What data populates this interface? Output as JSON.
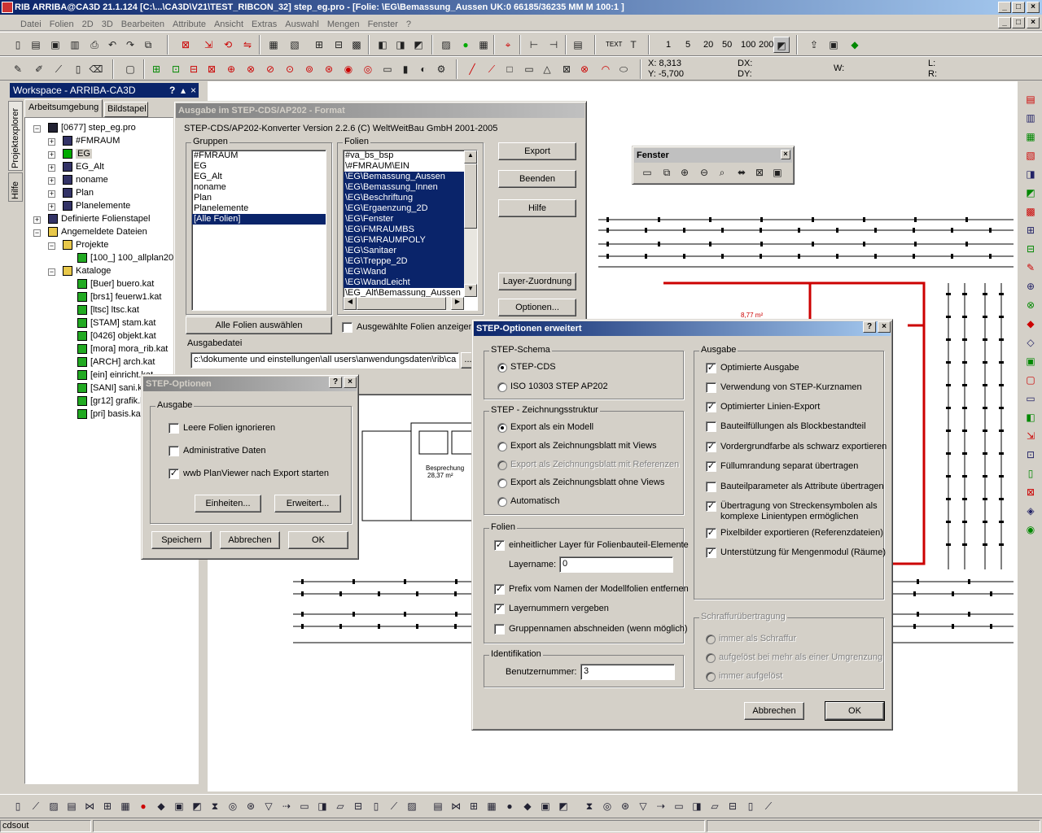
{
  "window": {
    "title": "RIB ARRIBA@CA3D 21.1.124 [C:\\...\\CA3D\\V21\\TEST_RIBCON_32] step_eg.pro - [Folie: \\EG\\Bemassung_Aussen     UK:0     66185/36235 MM     M 100:1     ]",
    "min": "_",
    "max": "□",
    "close": "×",
    "mdi_min": "_",
    "mdi_max": "□",
    "mdi_close": "×"
  },
  "menu": [
    "Datei",
    "Folien",
    "2D",
    "3D",
    "Bearbeiten",
    "Attribute",
    "Ansicht",
    "Extras",
    "Auswahl",
    "Mengen",
    "Fenster",
    "?"
  ],
  "toolbar1": {
    "text_label": "TEXT",
    "scales": [
      "1",
      "5",
      "20",
      "50",
      "100",
      "200"
    ]
  },
  "coords": {
    "x": "X: 8,313",
    "y": "Y: -5,700",
    "dx": "DX:",
    "dy": "DY:",
    "w": "W:",
    "l": "L:",
    "r": "R:"
  },
  "workspace": {
    "title": "Workspace - ARRIBA-CA3D",
    "help_q": "?",
    "pin": "▴",
    "close": "×",
    "tabs": [
      "Arbeitsumgebung",
      "Bildstapel"
    ],
    "side_tabs": [
      "Projektexplorer",
      "Hilfe"
    ],
    "tree": [
      {
        "label": "[0677] step_eg.pro",
        "level": 0,
        "icon": "project"
      },
      {
        "label": "#FMRAUM",
        "level": 1,
        "icon": "layer"
      },
      {
        "label": "EG",
        "level": 1,
        "icon": "layer-active"
      },
      {
        "label": "EG_Alt",
        "level": 1,
        "icon": "layer"
      },
      {
        "label": "noname",
        "level": 1,
        "icon": "layer"
      },
      {
        "label": "Plan",
        "level": 1,
        "icon": "layer"
      },
      {
        "label": "Planelemente",
        "level": 1,
        "icon": "layer"
      },
      {
        "label": "Definierte Folienstapel",
        "level": 0,
        "icon": "stack"
      },
      {
        "label": "Angemeldete Dateien",
        "level": 0,
        "icon": "folder"
      },
      {
        "label": "Projekte",
        "level": 1,
        "icon": "folder"
      },
      {
        "label": "[100_] 100_allplan20",
        "level": 2,
        "icon": "file"
      },
      {
        "label": "Kataloge",
        "level": 1,
        "icon": "folder"
      },
      {
        "label": "[Buer] buero.kat",
        "level": 2,
        "icon": "file"
      },
      {
        "label": "[brs1] feuerw1.kat",
        "level": 2,
        "icon": "file"
      },
      {
        "label": "[ltsc] ltsc.kat",
        "level": 2,
        "icon": "file"
      },
      {
        "label": "[STAM] stam.kat",
        "level": 2,
        "icon": "file"
      },
      {
        "label": "[0426] objekt.kat",
        "level": 2,
        "icon": "file"
      },
      {
        "label": "[mora] mora_rib.kat",
        "level": 2,
        "icon": "file"
      },
      {
        "label": "[ARCH] arch.kat",
        "level": 2,
        "icon": "file"
      },
      {
        "label": "[ein] einricht.kat",
        "level": 2,
        "icon": "file"
      },
      {
        "label": "[SANI] sani.kat",
        "level": 2,
        "icon": "file"
      },
      {
        "label": "[gr12] grafik.kat",
        "level": 2,
        "icon": "file"
      },
      {
        "label": "[pri] basis.kat",
        "level": 2,
        "icon": "file"
      }
    ]
  },
  "export_dialog": {
    "title": "Ausgabe im STEP-CDS/AP202 - Format",
    "version": "STEP-CDS/AP202-Konverter Version 2.2.6 (C) WeltWeitBau GmbH 2001-2005",
    "gruppen_label": "Gruppen",
    "gruppen": [
      "#FMRAUM",
      "EG",
      "EG_Alt",
      "noname",
      "Plan",
      "Planelemente",
      "[Alle Folien]"
    ],
    "gruppen_selected": 6,
    "folien_label": "Folien",
    "folien": [
      "#va_bs_bsp",
      "\\#FMRAUM\\EIN",
      "\\EG\\Bemassung_Aussen",
      "\\EG\\Bemassung_Innen",
      "\\EG\\Beschriftung",
      "\\EG\\Ergaenzung_2D",
      "\\EG\\Fenster",
      "\\EG\\FMRAUMBS",
      "\\EG\\FMRAUMPOLY",
      "\\EG\\Sanitaer",
      "\\EG\\Treppe_2D",
      "\\EG\\Wand",
      "\\EG\\WandLeicht",
      "\\EG_Alt\\Bemassung_Aussen"
    ],
    "folien_selected": [
      2,
      3,
      4,
      5,
      6,
      7,
      8,
      9,
      10,
      11,
      12
    ],
    "btn_export": "Export",
    "btn_beenden": "Beenden",
    "btn_hilfe": "Hilfe",
    "btn_layer": "Layer-Zuordnung",
    "btn_optionen": "Optionen...",
    "btn_alle": "Alle Folien auswählen",
    "cb_ausgewaehlt": "Ausgewählte Folien anzeigen",
    "ausgabedatei_label": "Ausgabedatei",
    "ausgabedatei_value": "c:\\dokumente und einstellungen\\all users\\anwendungsdaten\\rib\\ca",
    "browse": "..."
  },
  "fenster_toolbar": {
    "title": "Fenster",
    "close": "×"
  },
  "step_options": {
    "title": "STEP-Optionen",
    "help": "?",
    "close": "×",
    "group": "Ausgabe",
    "options": [
      {
        "label": "Leere Folien ignorieren",
        "checked": false
      },
      {
        "label": "Administrative Daten",
        "checked": false
      },
      {
        "label": "wwb PlanViewer nach Export starten",
        "checked": true
      }
    ],
    "btn_einheiten": "Einheiten...",
    "btn_erweitert": "Erweitert...",
    "btn_speichern": "Speichern",
    "btn_abbrechen": "Abbrechen",
    "btn_ok": "OK",
    "check": "✓"
  },
  "step_ext": {
    "title": "STEP-Optionen erweitert",
    "help": "?",
    "close": "×",
    "schema_label": "STEP-Schema",
    "schema": [
      {
        "label": "STEP-CDS",
        "on": true
      },
      {
        "label": "ISO 10303 STEP AP202",
        "on": false
      }
    ],
    "struct_label": "STEP - Zeichnungsstruktur",
    "struct": [
      {
        "label": "Export als ein Modell",
        "on": true,
        "dis": false
      },
      {
        "label": "Export als Zeichnungsblatt mit Views",
        "on": false,
        "dis": false
      },
      {
        "label": "Export als Zeichnungsblatt mit Referenzen",
        "on": false,
        "dis": true
      },
      {
        "label": "Export als Zeichnungsblatt ohne Views",
        "on": false,
        "dis": false
      },
      {
        "label": "Automatisch",
        "on": false,
        "dis": false
      }
    ],
    "folien_label": "Folien",
    "folien_opts": [
      {
        "label": "einheitlicher Layer für Folienbauteil-Elemente",
        "checked": true
      },
      {
        "label": "Prefix vom Namen der Modellfolien entfernen",
        "checked": true
      },
      {
        "label": "Layernummern vergeben",
        "checked": true
      },
      {
        "label": "Gruppennamen abschneiden (wenn möglich)",
        "checked": false
      }
    ],
    "layername_label": "Layername:",
    "layername_value": "0",
    "ident_label": "Identifikation",
    "benutzer_label": "Benutzernummer:",
    "benutzer_value": "3",
    "ausgabe_label": "Ausgabe",
    "ausgabe": [
      {
        "label": "Optimierte Ausgabe",
        "checked": true
      },
      {
        "label": "Verwendung von STEP-Kurznamen",
        "checked": false
      },
      {
        "label": "Optimierter Linien-Export",
        "checked": true
      },
      {
        "label": "Bauteilfüllungen als Blockbestandteil",
        "checked": false
      },
      {
        "label": "Vordergrundfarbe als schwarz exportieren",
        "checked": true
      },
      {
        "label": "Füllumrandung separat übertragen",
        "checked": true
      },
      {
        "label": "Bauteilparameter als Attribute übertragen",
        "checked": false
      },
      {
        "label": "Übertragung von Streckensymbolen als",
        "label2": "komplexe Linientypen ermöglichen",
        "checked": true
      },
      {
        "label": "Pixelbilder exportieren (Referenzdateien)",
        "checked": true
      },
      {
        "label": "Unterstützung für Mengenmodul (Räume)",
        "checked": true
      }
    ],
    "schraffur_label": "Schraffurübertragung",
    "schraffur": [
      "immer als Schraffur",
      "aufgelöst bei mehr als einer Umgrenzung",
      "immer aufgelöst"
    ],
    "btn_abbrechen": "Abbrechen",
    "btn_ok": "OK",
    "check": "✓"
  },
  "drawing": {
    "room_label": "Besprechung",
    "room_area": "28,37 m²",
    "room_label2": "8,77 m²"
  },
  "status": {
    "text": "cdsout"
  }
}
